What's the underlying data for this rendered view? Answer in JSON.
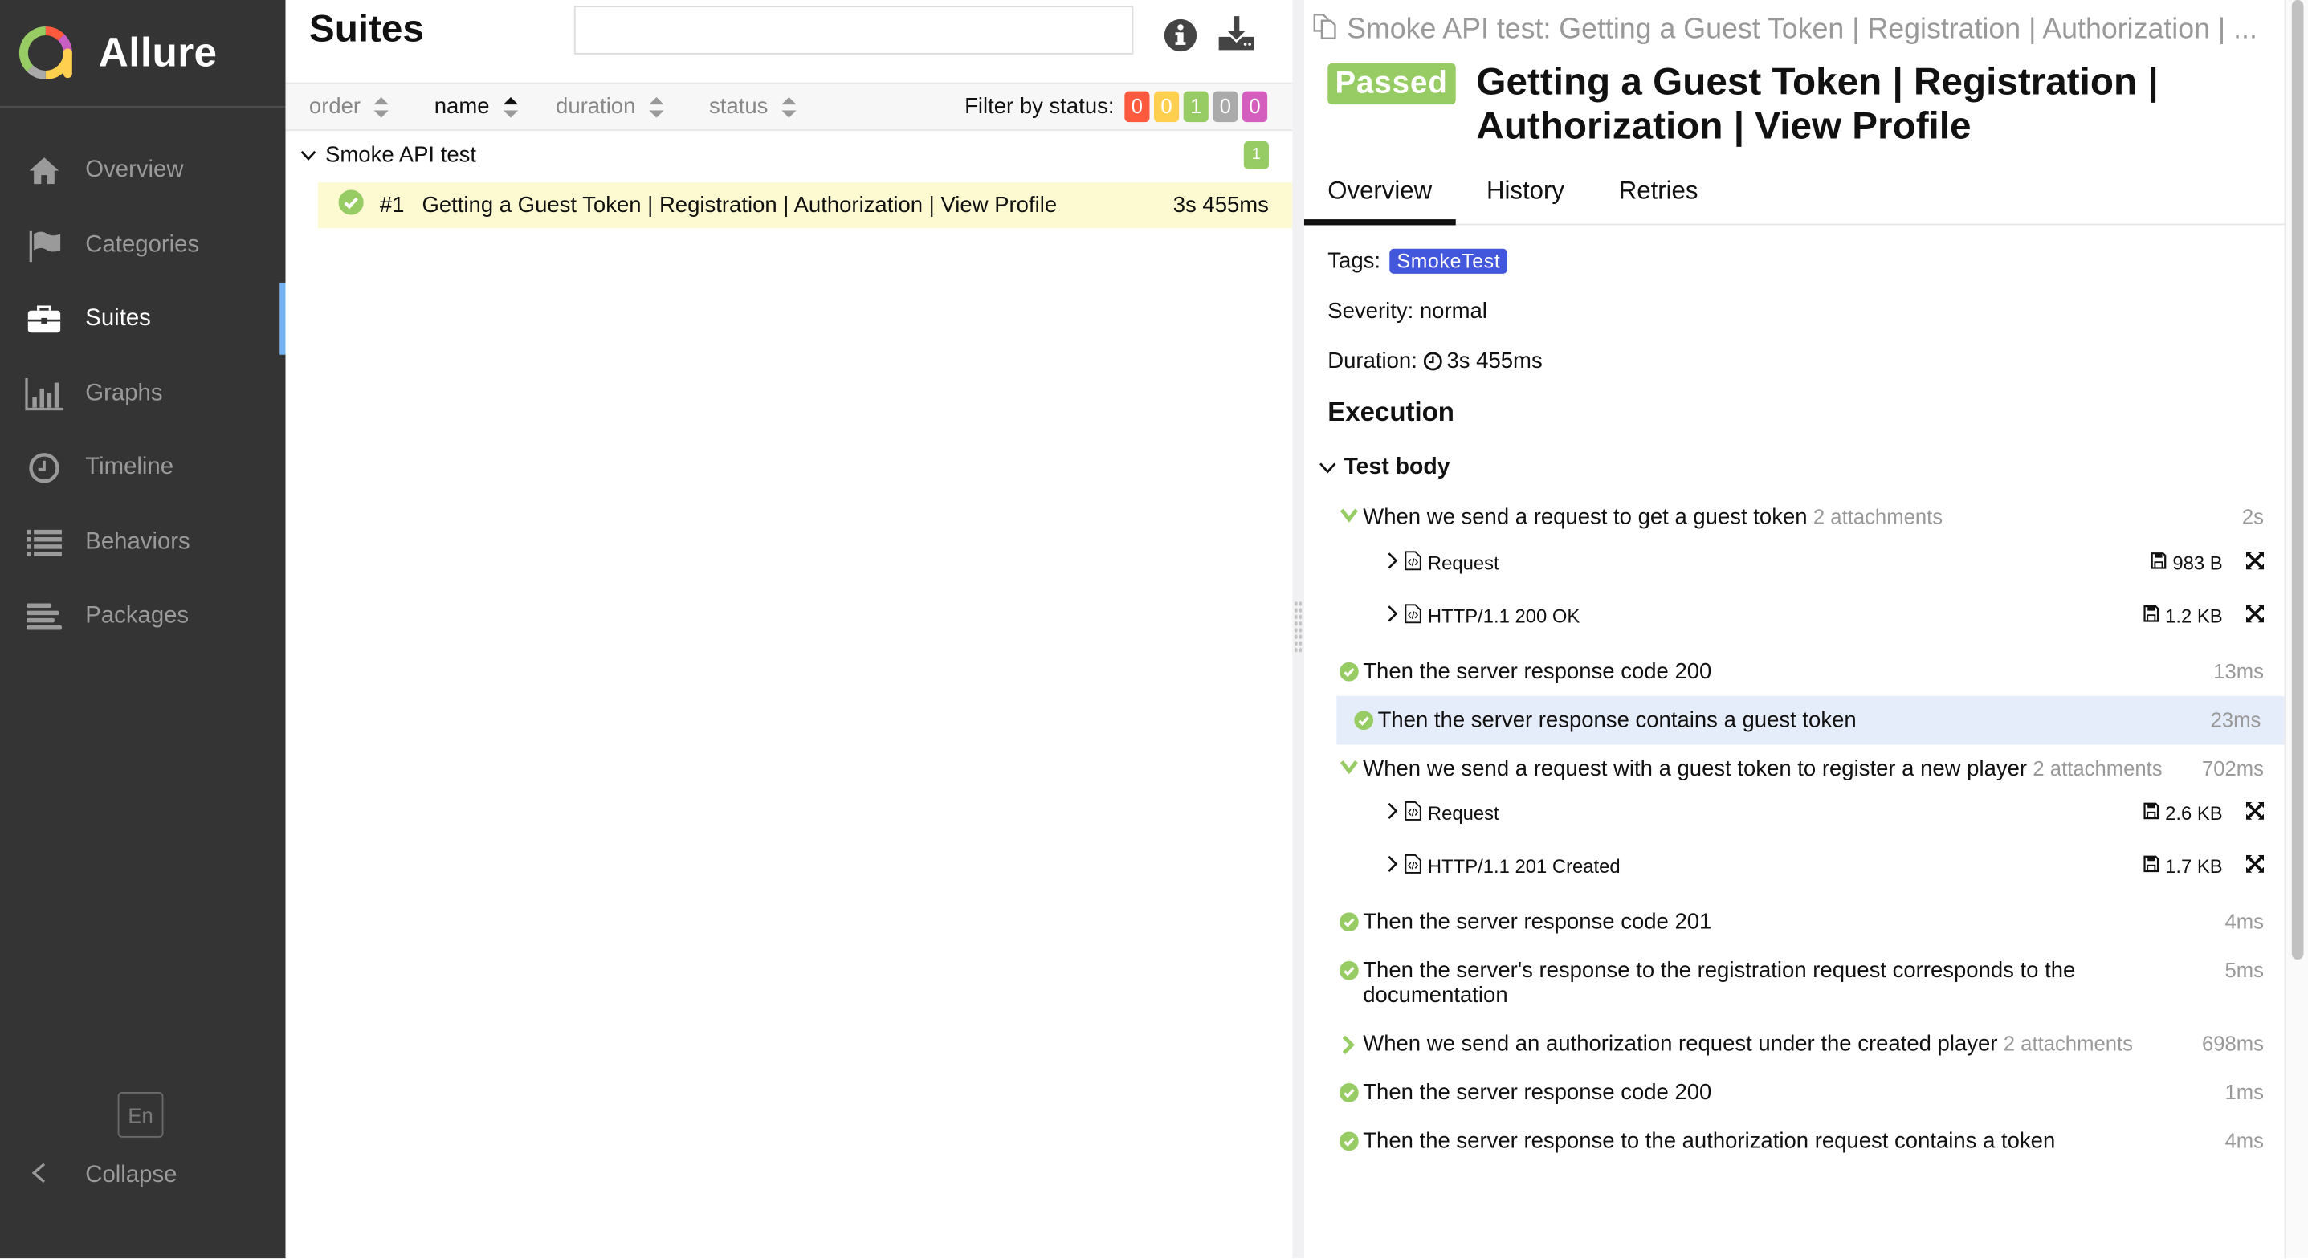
{
  "app": {
    "name": "Allure"
  },
  "sidebar": {
    "items": [
      {
        "label": "Overview",
        "icon": "home-icon",
        "active": false
      },
      {
        "label": "Categories",
        "icon": "flag-icon",
        "active": false
      },
      {
        "label": "Suites",
        "icon": "briefcase-icon",
        "active": true
      },
      {
        "label": "Graphs",
        "icon": "bar-chart-icon",
        "active": false
      },
      {
        "label": "Timeline",
        "icon": "clock-icon",
        "active": false
      },
      {
        "label": "Behaviors",
        "icon": "list-icon",
        "active": false
      },
      {
        "label": "Packages",
        "icon": "align-left-icon",
        "active": false
      }
    ],
    "language": "En",
    "collapse_label": "Collapse"
  },
  "suites": {
    "title": "Suites",
    "search": {
      "value": "",
      "placeholder": ""
    },
    "sort": [
      {
        "label": "order",
        "active": false
      },
      {
        "label": "name",
        "active": true
      },
      {
        "label": "duration",
        "active": false
      },
      {
        "label": "status",
        "active": false
      }
    ],
    "filter_label": "Filter by status:",
    "status_counts": [
      {
        "status": "failed",
        "count": "0",
        "color": "#fd5a3e"
      },
      {
        "status": "broken",
        "count": "0",
        "color": "#ffd050"
      },
      {
        "status": "passed",
        "count": "1",
        "color": "#97cc64"
      },
      {
        "status": "skipped",
        "count": "0",
        "color": "#aaaaaa"
      },
      {
        "status": "unknown",
        "count": "0",
        "color": "#d35ebe"
      }
    ],
    "group": {
      "name": "Smoke API test",
      "count": "1"
    },
    "tests": [
      {
        "number": "#1",
        "name": "Getting a Guest Token | Registration | Authorization | View Profile",
        "duration": "3s 455ms",
        "status": "passed"
      }
    ]
  },
  "detail": {
    "breadcrumb": "Smoke API test: Getting a Guest Token | Registration | Authorization | ...",
    "status": "Passed",
    "title": "Getting a Guest Token | Registration | Authorization | View Profile",
    "tabs": [
      {
        "label": "Overview",
        "active": true
      },
      {
        "label": "History",
        "active": false
      },
      {
        "label": "Retries",
        "active": false
      }
    ],
    "tags_label": "Tags:",
    "tags": [
      "SmokeTest"
    ],
    "severity": "Severity: normal",
    "duration_label": "Duration:",
    "duration": "3s 455ms",
    "execution_title": "Execution",
    "test_body_label": "Test body",
    "steps": [
      {
        "text": "When we send a request to get a guest token",
        "attachments": "2 attachments",
        "duration": "2s",
        "state": "expanded"
      },
      {
        "text": "Then the server response code 200",
        "attachments": "",
        "duration": "13ms",
        "state": "passed"
      },
      {
        "text": "Then the server response contains a guest token",
        "attachments": "",
        "duration": "23ms",
        "state": "passed"
      },
      {
        "text": "When we send a request with a guest token to register a new player",
        "attachments": "2 attachments",
        "duration": "702ms",
        "state": "expanded"
      },
      {
        "text": "Then the server response code 201",
        "attachments": "",
        "duration": "4ms",
        "state": "passed"
      },
      {
        "text": "Then the server's response to the registration request corresponds to the documentation",
        "attachments": "",
        "duration": "5ms",
        "state": "passed"
      },
      {
        "text": "When we send an authorization request under the created player",
        "attachments": "2 attachments",
        "duration": "698ms",
        "state": "collapsed"
      },
      {
        "text": "Then the server response code 200",
        "attachments": "",
        "duration": "1ms",
        "state": "passed"
      },
      {
        "text": "Then the server response to the authorization request contains a token",
        "attachments": "",
        "duration": "4ms",
        "state": "passed"
      }
    ],
    "attachments": [
      {
        "name": "Request",
        "size": "983 B"
      },
      {
        "name": "HTTP/1.1 200 OK",
        "size": "1.2 KB"
      },
      {
        "name": "Request",
        "size": "2.6 KB"
      },
      {
        "name": "HTTP/1.1 201 Created",
        "size": "1.7 KB"
      }
    ]
  },
  "colors": {
    "accent": "#74b3f1",
    "passed": "#97cc64",
    "tag": "#4357dc",
    "sidebar_bg": "#343434",
    "selected_row": "#fdf9d1",
    "hover_step": "#e6edfa"
  }
}
